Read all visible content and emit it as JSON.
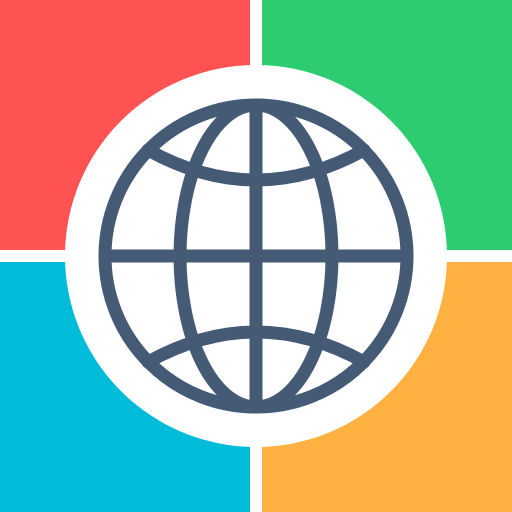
{
  "app_icon": {
    "icon_name": "globe-icon",
    "colors": {
      "background": "#ffffff",
      "top_left": "#ff5252",
      "top_right": "#2ecc71",
      "bottom_left": "#00bcd8",
      "bottom_right": "#ffb142",
      "center_disc": "#ffffff",
      "globe_stroke": "#455a75"
    }
  }
}
